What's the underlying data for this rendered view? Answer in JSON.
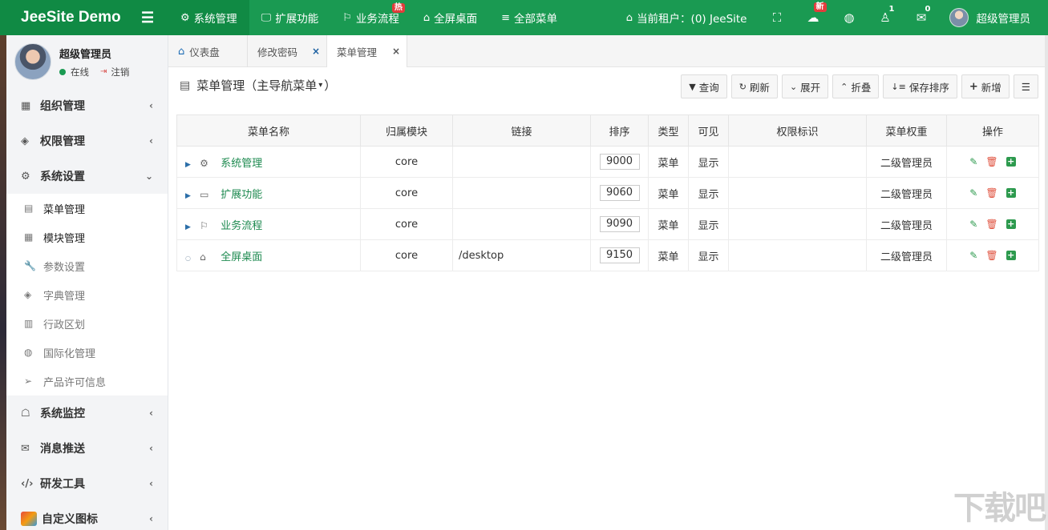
{
  "app": {
    "brand": "JeeSite Demo"
  },
  "topnav": {
    "items": [
      {
        "label": "系统管理",
        "icon": "gear-icon",
        "active": true
      },
      {
        "label": "扩展功能",
        "icon": "monitor-icon"
      },
      {
        "label": "业务流程",
        "icon": "flag-icon",
        "badge": "热"
      },
      {
        "label": "全屏桌面",
        "icon": "home-icon"
      },
      {
        "label": "全部菜单",
        "icon": "list-icon"
      }
    ],
    "tenant": "当前租户：(0) JeeSite",
    "weather_badge": "新",
    "notify_count": "1",
    "mail_count": "0",
    "user": "超级管理员"
  },
  "sidebar": {
    "user_name": "超级管理员",
    "status": "在线",
    "logout": "注销",
    "groups": [
      {
        "label": "组织管理",
        "icon": "grid-icon"
      },
      {
        "label": "权限管理",
        "icon": "layers-icon"
      },
      {
        "label": "系统设置",
        "icon": "gear-icon",
        "open": true
      },
      {
        "label": "系统监控",
        "icon": "ghost-icon"
      },
      {
        "label": "消息推送",
        "icon": "envelope-icon"
      },
      {
        "label": "研发工具",
        "icon": "code-icon"
      },
      {
        "label": "自定义图标",
        "icon": "custom-icon"
      }
    ],
    "sub_items": [
      {
        "label": "菜单管理",
        "icon": "book-icon",
        "active": true
      },
      {
        "label": "模块管理",
        "icon": "grid-icon"
      },
      {
        "label": "参数设置",
        "icon": "wrench-icon"
      },
      {
        "label": "字典管理",
        "icon": "layers-icon"
      },
      {
        "label": "行政区划",
        "icon": "map-icon"
      },
      {
        "label": "国际化管理",
        "icon": "globe-icon"
      },
      {
        "label": "产品许可信息",
        "icon": "paper-plane-icon"
      }
    ]
  },
  "tabs": [
    {
      "label": "仪表盘"
    },
    {
      "label": "修改密码"
    },
    {
      "label": "菜单管理",
      "active": true
    }
  ],
  "page": {
    "title": "菜单管理（主导航菜单",
    "title_end": "）",
    "buttons": {
      "query": "查询",
      "refresh": "刷新",
      "expand": "展开",
      "collapse": "折叠",
      "save_sort": "保存排序",
      "add": "新增"
    }
  },
  "table": {
    "headers": [
      "菜单名称",
      "归属模块",
      "链接",
      "排序",
      "类型",
      "可见",
      "权限标识",
      "菜单权重",
      "操作"
    ],
    "rows": [
      {
        "name": "系统管理",
        "icon": "gear-icon",
        "module": "core",
        "url": "",
        "sort": "9000",
        "type": "菜单",
        "visible": "显示",
        "perm": "",
        "weight": "二级管理员"
      },
      {
        "name": "扩展功能",
        "icon": "monitor-icon",
        "module": "core",
        "url": "",
        "sort": "9060",
        "type": "菜单",
        "visible": "显示",
        "perm": "",
        "weight": "二级管理员"
      },
      {
        "name": "业务流程",
        "icon": "flag-icon",
        "module": "core",
        "url": "",
        "sort": "9090",
        "type": "菜单",
        "visible": "显示",
        "perm": "",
        "weight": "二级管理员"
      },
      {
        "name": "全屏桌面",
        "icon": "home-icon",
        "module": "core",
        "url": "/desktop",
        "sort": "9150",
        "type": "菜单",
        "visible": "显示",
        "perm": "",
        "weight": "二级管理员"
      }
    ]
  },
  "colors": {
    "primary": "#1a9a52",
    "primary_dark": "#108a44",
    "danger": "#e0523f"
  }
}
